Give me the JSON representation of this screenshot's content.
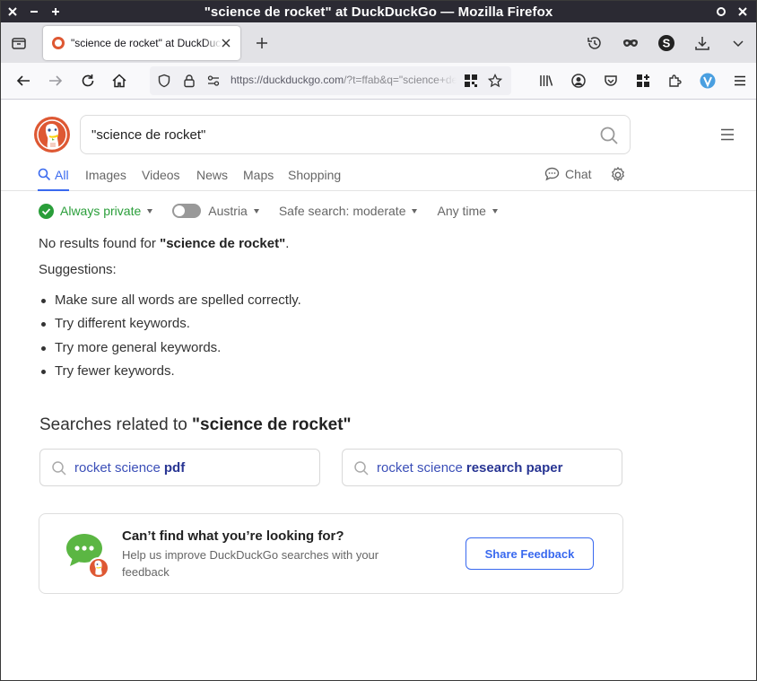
{
  "window": {
    "title": "\"science de rocket\" at DuckDuckGo — Mozilla Firefox"
  },
  "tab": {
    "title": "\"science de rocket\" at DuckDuckGo"
  },
  "urlbar": {
    "url_host": "https://duckduckgo.com",
    "url_path": "/?t=ffab&q=\"science+de+rocket\"&ia=web"
  },
  "search": {
    "query": "\"science de rocket\""
  },
  "search_tabs": [
    {
      "label": "All"
    },
    {
      "label": "Images"
    },
    {
      "label": "Videos"
    },
    {
      "label": "News"
    },
    {
      "label": "Maps"
    },
    {
      "label": "Shopping"
    }
  ],
  "chat_label": "Chat",
  "filters": {
    "private": "Always private",
    "region": "Austria",
    "safe_search": "Safe search: moderate",
    "time": "Any time"
  },
  "results": {
    "no_results_prefix": "No results found for ",
    "no_results_query": "\"science de rocket\"",
    "no_results_suffix": ".",
    "suggestions_title": "Suggestions:",
    "suggestions": [
      "Make sure all words are spelled correctly.",
      "Try different keywords.",
      "Try more general keywords.",
      "Try fewer keywords."
    ]
  },
  "related": {
    "title_prefix": "Searches related to ",
    "title_query": "\"science de rocket\"",
    "items": [
      {
        "pre": "rocket science",
        "post": "pdf"
      },
      {
        "pre": "rocket science",
        "post": "research paper"
      }
    ]
  },
  "feedback": {
    "title": "Can’t find what you’re looking for?",
    "subtitle": "Help us improve DuckDuckGo searches with your feedback",
    "button": "Share Feedback"
  },
  "colors": {
    "accent": "#3969ef",
    "private_green": "#2a9e3a",
    "ddg_orange": "#de5833",
    "related_link": "#3b4fb8"
  }
}
